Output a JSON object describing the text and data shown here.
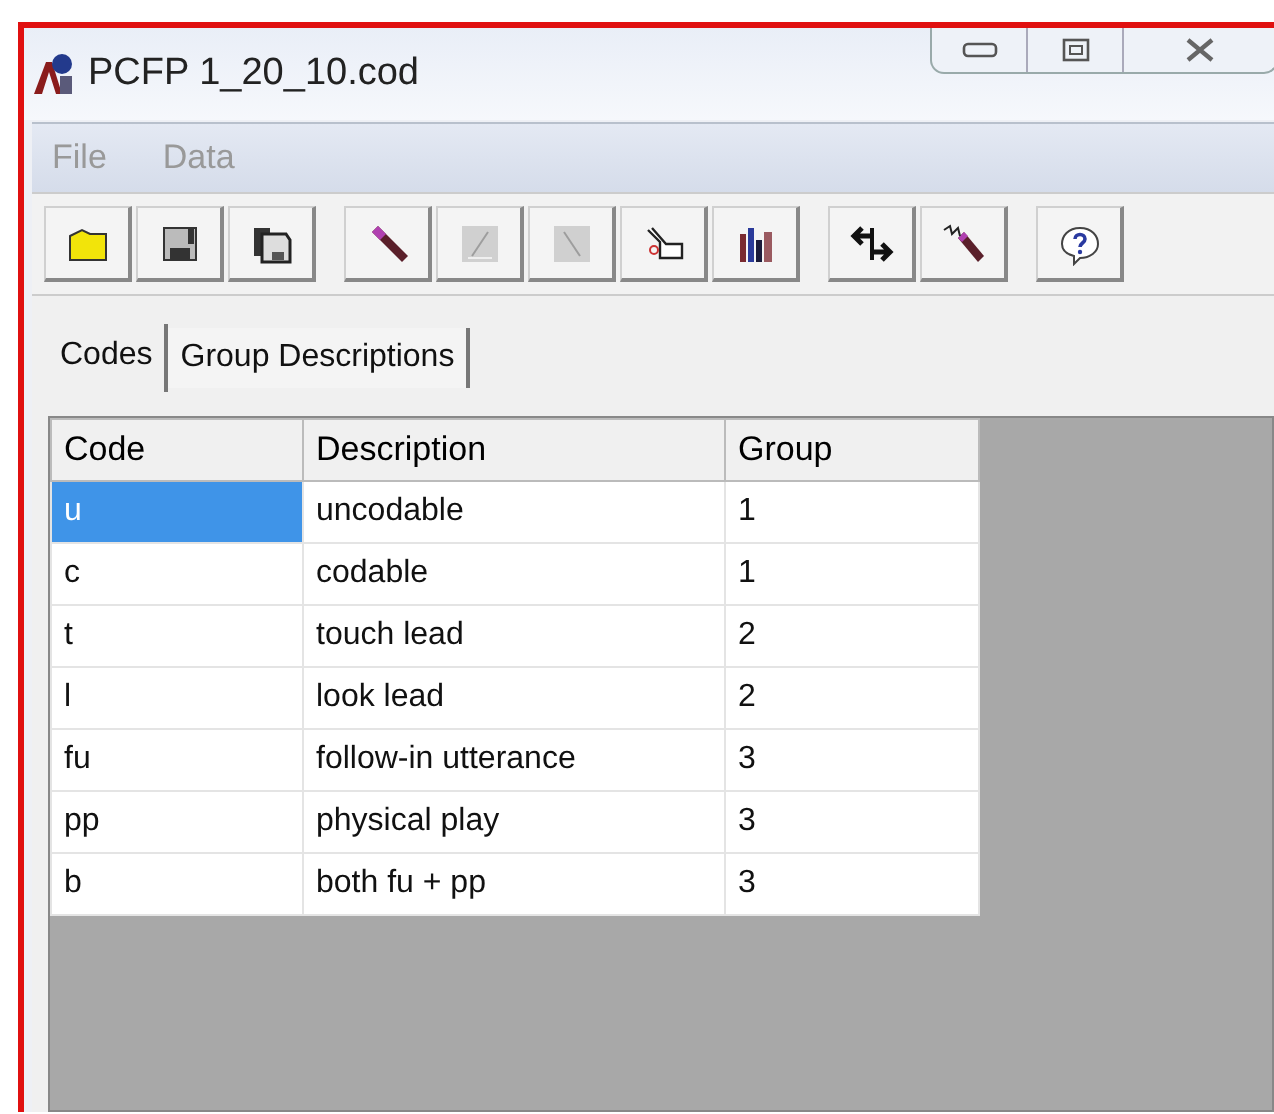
{
  "window": {
    "title": "PCFP 1_20_10.cod"
  },
  "menu": [
    {
      "label": "File"
    },
    {
      "label": "Data"
    }
  ],
  "toolbar": [
    [
      {
        "kind": "open",
        "disabled": false
      },
      {
        "kind": "save",
        "disabled": false
      },
      {
        "kind": "saveas",
        "disabled": false
      }
    ],
    [
      {
        "kind": "pen",
        "disabled": false
      },
      {
        "kind": "line",
        "disabled": true
      },
      {
        "kind": "backline",
        "disabled": true
      },
      {
        "kind": "hand",
        "disabled": false
      },
      {
        "kind": "bars",
        "disabled": false
      }
    ],
    [
      {
        "kind": "arrows",
        "disabled": false
      },
      {
        "kind": "wand",
        "disabled": false
      }
    ],
    [
      {
        "kind": "help",
        "disabled": false
      }
    ]
  ],
  "tabs": [
    {
      "label": "Codes",
      "selected": true
    },
    {
      "label": "Group Descriptions",
      "selected": false
    }
  ],
  "table": {
    "columns": [
      "Code",
      "Description",
      "Group"
    ],
    "rows": [
      {
        "cells": [
          "u",
          "uncodable",
          "1"
        ],
        "selected": true
      },
      {
        "cells": [
          "c",
          "codable",
          "1"
        ],
        "selected": false
      },
      {
        "cells": [
          "t",
          "touch lead",
          "2"
        ],
        "selected": false
      },
      {
        "cells": [
          "l",
          "look lead",
          "2"
        ],
        "selected": false
      },
      {
        "cells": [
          "fu",
          "follow-in utterance",
          "3"
        ],
        "selected": false
      },
      {
        "cells": [
          "pp",
          "physical play",
          "3"
        ],
        "selected": false
      },
      {
        "cells": [
          "b",
          "both fu + pp",
          "3"
        ],
        "selected": false
      }
    ]
  }
}
